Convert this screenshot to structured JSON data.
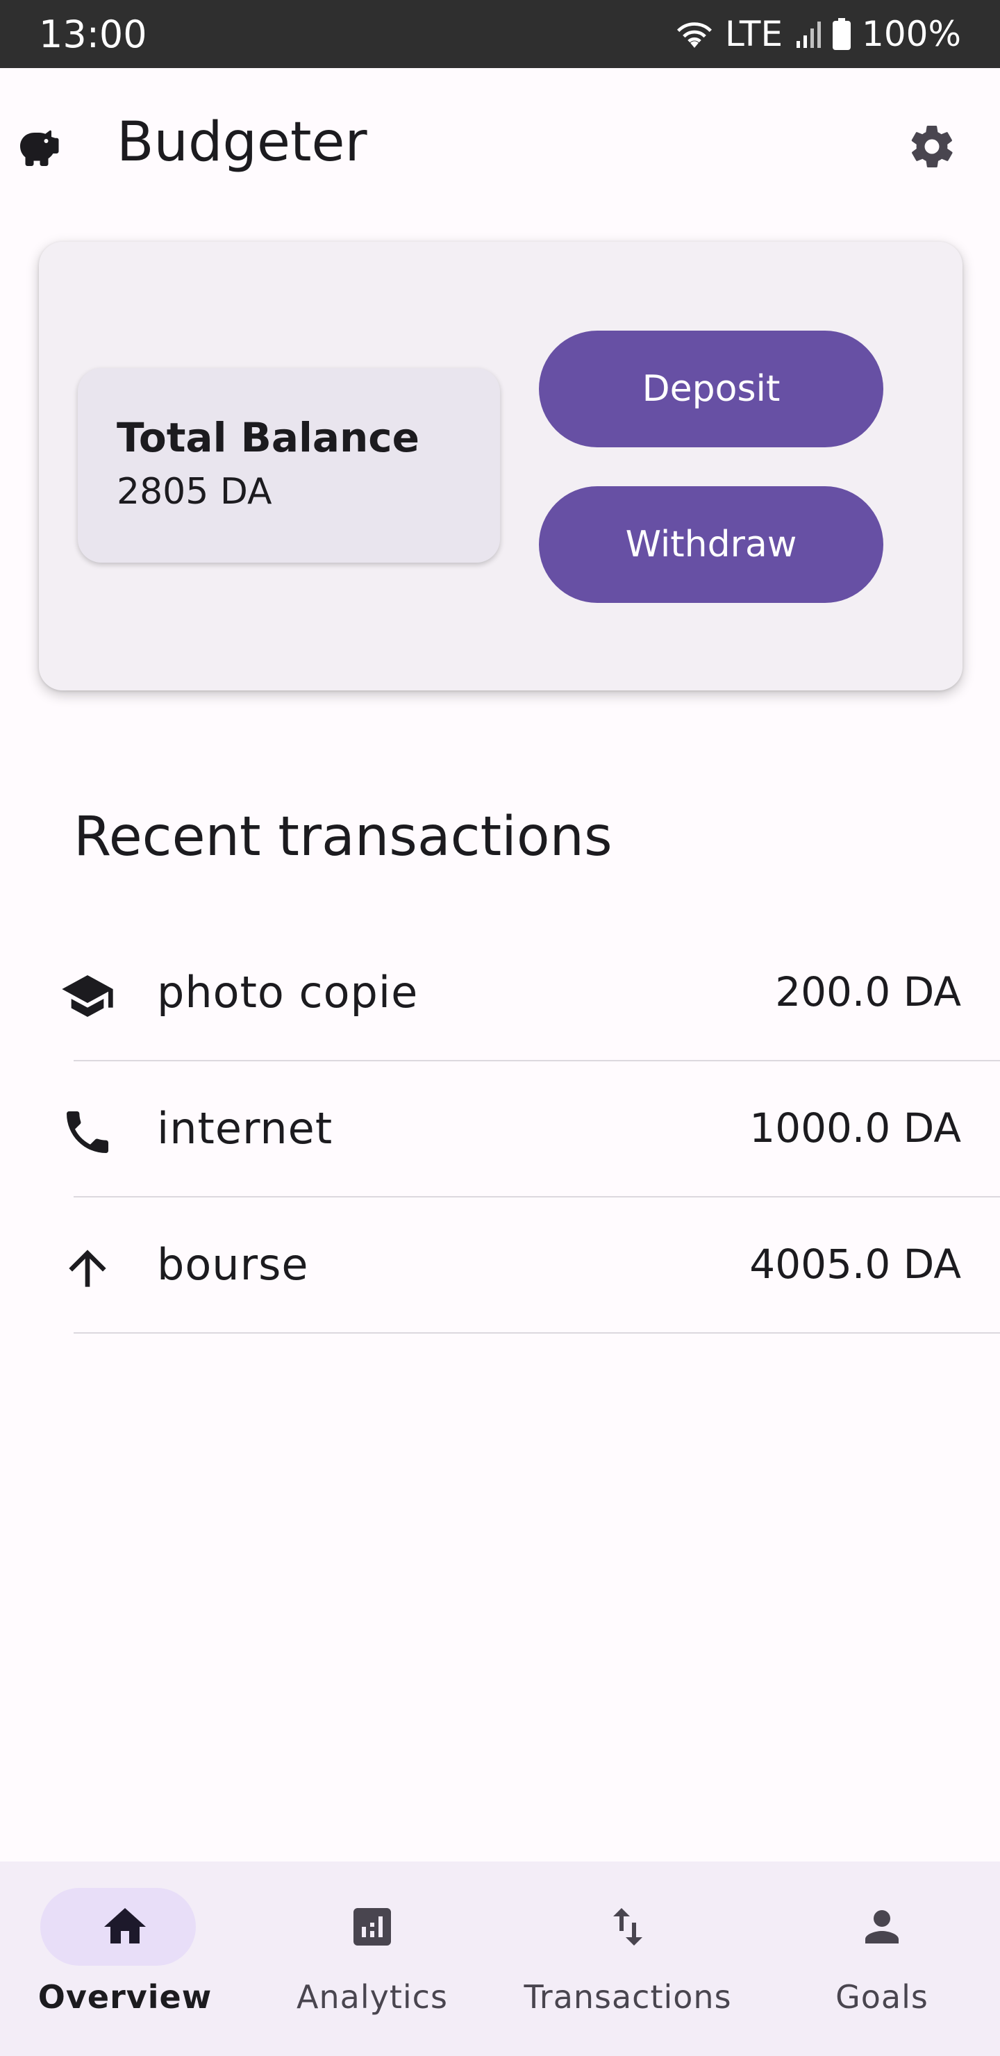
{
  "status_bar": {
    "time": "13:00",
    "network": "LTE",
    "battery": "100%"
  },
  "app_bar": {
    "title": "Budgeter",
    "logo_icon": "piggy-bank-icon",
    "settings_icon": "gear-icon"
  },
  "balance_card": {
    "label": "Total Balance",
    "value": "2805 DA",
    "deposit_label": "Deposit",
    "withdraw_label": "Withdraw"
  },
  "recent": {
    "title": "Recent transactions",
    "items": [
      {
        "icon": "graduation-cap-icon",
        "name": "photo copie",
        "amount": "200.0 DA"
      },
      {
        "icon": "phone-icon",
        "name": "internet",
        "amount": "1000.0 DA"
      },
      {
        "icon": "arrow-up-icon",
        "name": "bourse",
        "amount": "4005.0 DA"
      }
    ]
  },
  "nav": {
    "items": [
      {
        "label": "Overview",
        "icon": "home-icon",
        "active": true
      },
      {
        "label": "Analytics",
        "icon": "analytics-icon",
        "active": false
      },
      {
        "label": "Transactions",
        "icon": "swap-vertical-icon",
        "active": false
      },
      {
        "label": "Goals",
        "icon": "person-icon",
        "active": false
      }
    ]
  },
  "colors": {
    "primary": "#6750a4",
    "background": "#fffbfe",
    "card": "#f3eff4",
    "nav_background": "#f3edf7",
    "nav_active_pill": "#e8def8"
  }
}
